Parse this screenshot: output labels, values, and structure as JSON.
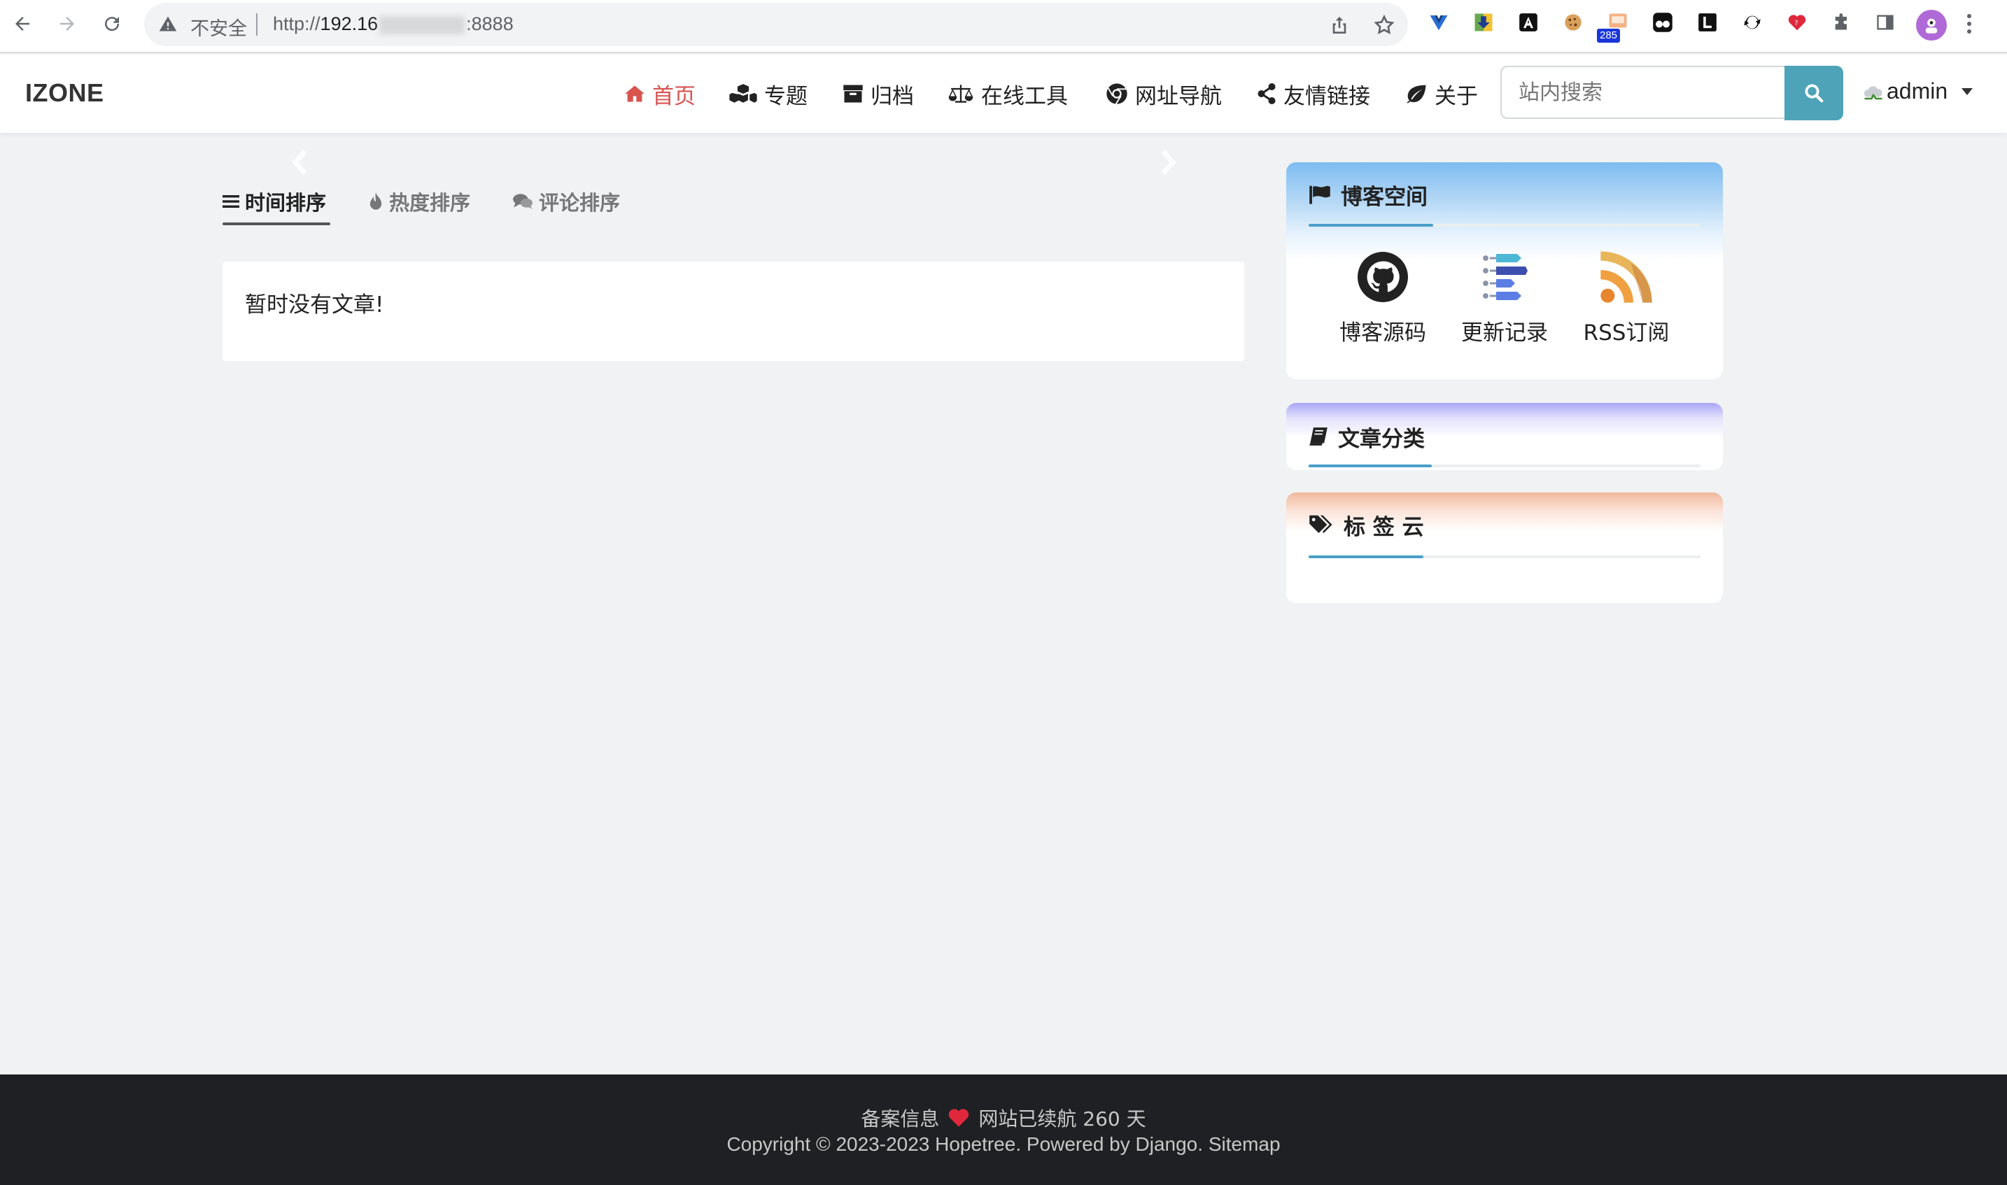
{
  "browser": {
    "insecure_label": "不安全",
    "url_prefix": "http://",
    "url_host_visible": "192.16",
    "url_port": ":8888",
    "ext_badge_count": "285"
  },
  "site": {
    "brand": "IZONE",
    "nav": [
      {
        "label": "首页",
        "icon": "home-icon",
        "active": true
      },
      {
        "label": "专题",
        "icon": "cubes-icon"
      },
      {
        "label": "归档",
        "icon": "archive-icon"
      },
      {
        "label": "在线工具",
        "icon": "balance-scale-icon"
      },
      {
        "label": "网址导航",
        "icon": "chrome-icon"
      },
      {
        "label": "友情链接",
        "icon": "share-icon"
      },
      {
        "label": "关于",
        "icon": "leaf-icon"
      }
    ],
    "search_placeholder": "站内搜索",
    "user_label": "admin"
  },
  "main": {
    "tabs": [
      {
        "label": "时间排序",
        "icon": "list-icon",
        "active": true
      },
      {
        "label": "热度排序",
        "icon": "fire-icon"
      },
      {
        "label": "评论排序",
        "icon": "comments-icon"
      }
    ],
    "empty_message": "暂时没有文章!"
  },
  "sidebar": {
    "blog_space": {
      "title": "博客空间",
      "items": [
        {
          "label": "博客源码",
          "icon": "github-icon"
        },
        {
          "label": "更新记录",
          "icon": "changelog-icon"
        },
        {
          "label": "RSS订阅",
          "icon": "rss-icon"
        }
      ]
    },
    "categories": {
      "title": "文章分类"
    },
    "tags": {
      "title": "标 签 云"
    }
  },
  "footer": {
    "beian": "备案信息",
    "uptime": "网站已续航 260 天",
    "copyright": "Copyright © 2023-2023 Hopetree. Powered by Django. Sitemap"
  },
  "colors": {
    "accent_active_nav": "#d9534f",
    "search_button": "#4ea3b8",
    "sidebar_underline": "#4a9fc8",
    "footer_bg": "#1f2023",
    "heart": "#e0283c"
  }
}
